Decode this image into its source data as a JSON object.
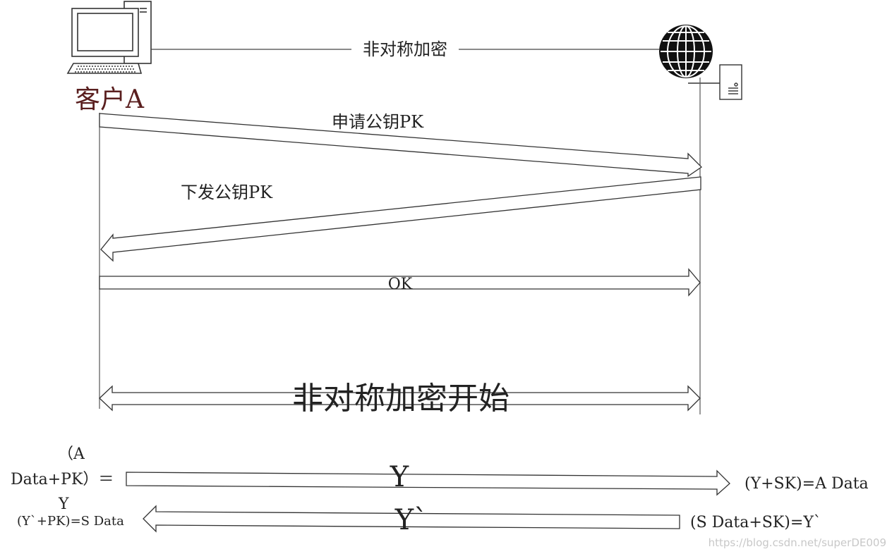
{
  "labels": {
    "top_channel": "非对称加密",
    "client": "客户A",
    "request_pk": "申请公钥PK",
    "issue_pk": "下发公钥PK",
    "ok": "OK",
    "encryption_start": "非对称加密开始",
    "left_formula_1": "（A",
    "left_formula_2": "Data+PK）＝",
    "left_formula_3": "Y",
    "arrow_y": "Y",
    "right_formula_1": "(Y+SK)=A Data",
    "left_formula_4": "(Y`+PK)=S Data",
    "arrow_y_prime": "Y`",
    "right_formula_2": "(S Data+SK)=Y`"
  },
  "watermark": "https://blog.csdn.net/superDE009",
  "colors": {
    "client_label": "#5a1f1f",
    "stroke": "#333333"
  },
  "icons": {
    "client": "computer-icon",
    "server_globe": "globe-icon",
    "server_box": "server-icon"
  }
}
